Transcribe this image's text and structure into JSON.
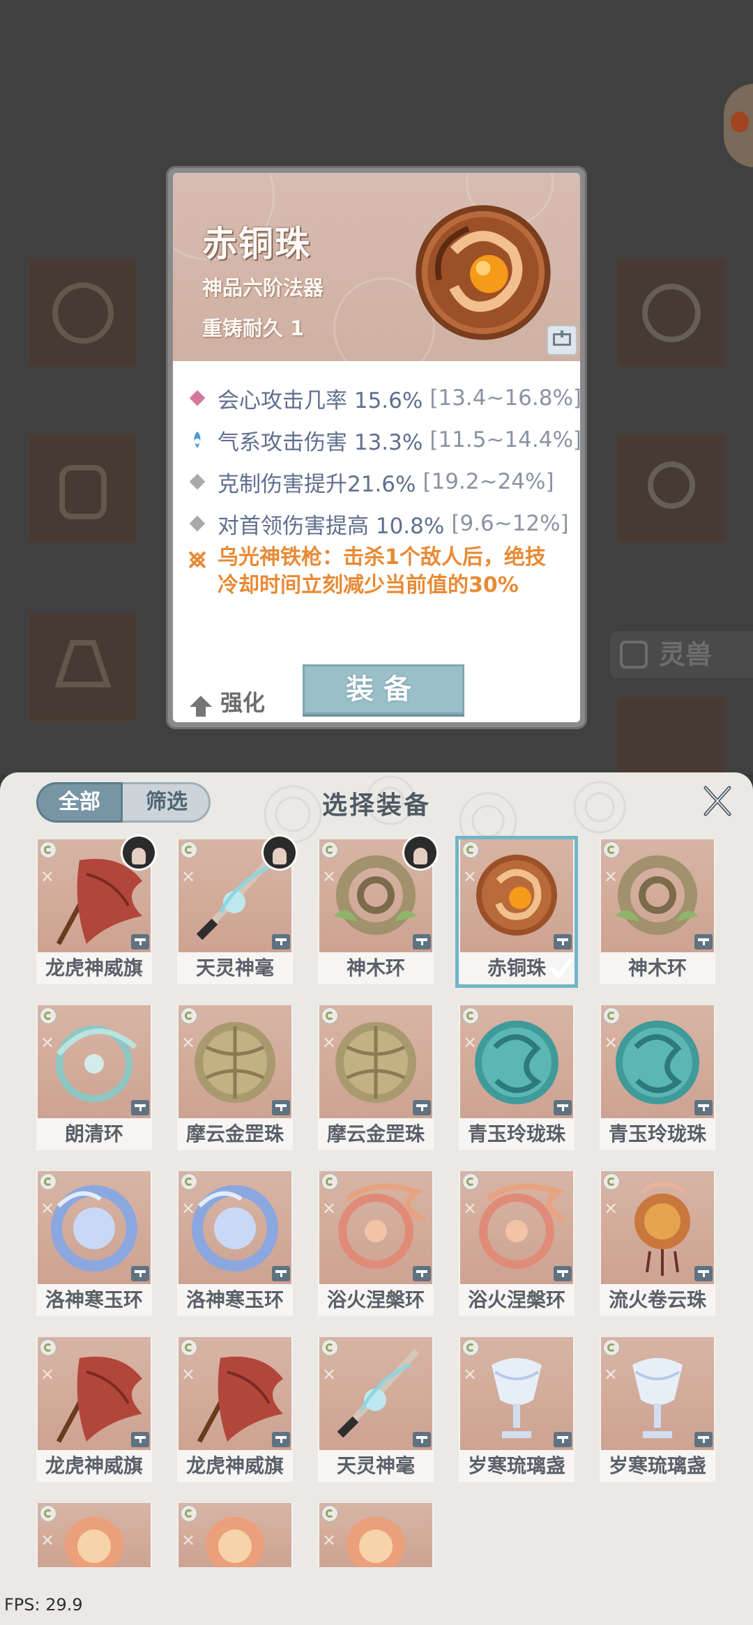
{
  "detail": {
    "name": "赤铜珠",
    "grade": "神品六阶法器",
    "durability": "重铸耐久 1",
    "stats": [
      {
        "text": "会心攻击几率 15.6%",
        "range": "[13.4~16.8%]",
        "icon": "pink-diamond-icon",
        "color": "#d2789d"
      },
      {
        "text": "气系攻击伤害 13.3%",
        "range": "[11.5~14.4%]",
        "icon": "qi-element-icon",
        "color": "#4d9bd3"
      },
      {
        "text": "克制伤害提升21.6%",
        "range": "[19.2~24%]",
        "icon": "gray-diamond-icon",
        "color": "#a9a9a9"
      },
      {
        "text": "对首领伤害提高 10.8%",
        "range": "[9.6~12%]",
        "icon": "gray-diamond-icon",
        "color": "#a9a9a9"
      }
    ],
    "special": "乌光神铁枪：击杀1个敌人后，绝技冷却时间立刻减少当前值的30%",
    "special_color": "#e88a35",
    "enhance_label": "强化",
    "equip_label": "装备"
  },
  "background": {
    "lingshou_label": "灵兽"
  },
  "panel": {
    "title": "选择装备",
    "filter_all": "全部",
    "filter_sift": "筛选",
    "close_icon": "close-x-icon",
    "items": [
      {
        "name": "龙虎神威旗",
        "art": "banner"
      },
      {
        "name": "天灵神毫",
        "art": "brush"
      },
      {
        "name": "神木环",
        "art": "wood-ring"
      },
      {
        "name": "赤铜珠",
        "art": "copper-bead"
      },
      {
        "name": "神木环",
        "art": "wood-ring"
      },
      {
        "name": "朗清环",
        "art": "clear-ring"
      },
      {
        "name": "摩云金罡珠",
        "art": "gold-bead"
      },
      {
        "name": "摩云金罡珠",
        "art": "gold-bead"
      },
      {
        "name": "青玉玲珑珠",
        "art": "jade-bead"
      },
      {
        "name": "青玉玲珑珠",
        "art": "jade-bead"
      },
      {
        "name": "洛神寒玉环",
        "art": "ice-ring"
      },
      {
        "name": "洛神寒玉环",
        "art": "ice-ring"
      },
      {
        "name": "浴火涅槃环",
        "art": "phoenix-ring"
      },
      {
        "name": "浴火涅槃环",
        "art": "phoenix-ring"
      },
      {
        "name": "流火卷云珠",
        "art": "fire-cloud-bead"
      },
      {
        "name": "龙虎神威旗",
        "art": "banner"
      },
      {
        "name": "龙虎神威旗",
        "art": "banner"
      },
      {
        "name": "天灵神毫",
        "art": "brush"
      },
      {
        "name": "岁寒琉璃盏",
        "art": "frost-cup"
      },
      {
        "name": "岁寒琉璃盏",
        "art": "frost-cup"
      },
      {
        "name": "",
        "art": "flame-orb"
      },
      {
        "name": "",
        "art": "flame-orb"
      },
      {
        "name": "",
        "art": "flame-orb"
      }
    ]
  },
  "fps": "FPS: 29.9",
  "colors": {
    "accent": "#6fb6c8",
    "stat_text": "#5f6f8e",
    "panel_bg": "#ebe9e5"
  }
}
